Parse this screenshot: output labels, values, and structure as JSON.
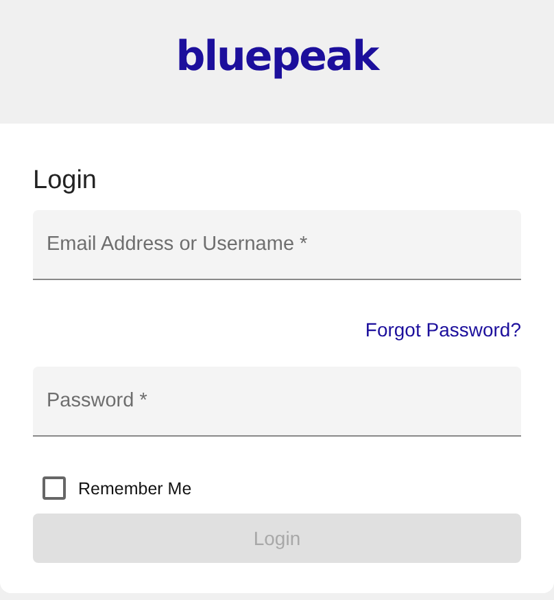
{
  "header": {
    "logo": "bluepeak"
  },
  "title": "Login",
  "fields": [
    {
      "placeholder": "Email Address or Username *"
    },
    {
      "placeholder": "Password *"
    }
  ],
  "forgot_link": "Forgot Password?",
  "remember": {
    "label": "Remember Me",
    "checked": false
  },
  "submit": {
    "label": "Login",
    "disabled": true
  }
}
